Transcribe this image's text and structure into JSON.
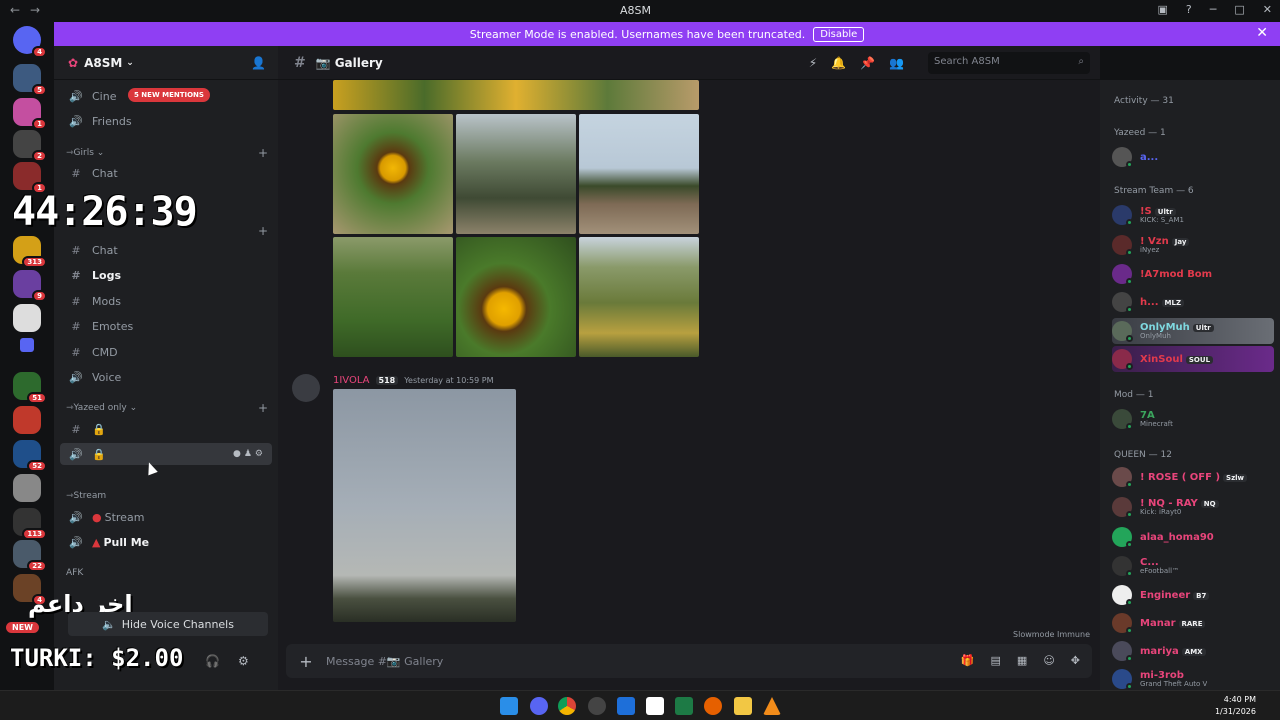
{
  "window": {
    "title": "A8SM"
  },
  "banner": {
    "text": "Streamer Mode is enabled. Usernames have been truncated.",
    "button": "Disable"
  },
  "server_badges": [
    "4",
    "5",
    "1",
    "2",
    "1",
    "313",
    "9",
    "51",
    "52",
    "113",
    "22",
    "4"
  ],
  "guild": {
    "name": "A8SM",
    "mentions_badge": "5 NEW MENTIONS"
  },
  "channels": {
    "cine": "Cine",
    "friends": "Friends",
    "cat_girls": "Girls",
    "girls_chat": "Chat",
    "chat2": "Chat",
    "logs": "Logs",
    "mods": "Mods",
    "emotes": "Emotes",
    "cmd": "CMD",
    "voice": "Voice",
    "cat_yazeed": "Yazeed only",
    "cat_stream": "Stream",
    "stream": "Stream",
    "pullme": "Pull Me",
    "afk": "AFK",
    "hide_vc": "Hide Voice Channels"
  },
  "overlay": {
    "timer": "44:26:39",
    "arabic": "اخر داعم",
    "donor": "TURKI: $2.00",
    "new": "NEW"
  },
  "channel_header": {
    "name": "Gallery",
    "search_placeholder": "Search A8SM"
  },
  "message": {
    "author": "1IVOLA",
    "tag": "518",
    "time": "Yesterday at 10:59 PM"
  },
  "slowmode": "Slowmode Immune",
  "composer": {
    "placeholder": "Message #📷 Gallery"
  },
  "members": {
    "activity": "Activity — 31",
    "yazeed": "Yazeed — 1",
    "yazeed_member": "a...",
    "stream_team": "Stream Team — 6",
    "mod": "Mod — 1",
    "queen": "QUEEN — 12",
    "list": [
      {
        "name": "!S",
        "tag": "Ultr",
        "sub": "KICK: S_AM1",
        "color": "#e23a4c"
      },
      {
        "name": "! Vzn",
        "tag": "Jay",
        "sub": "iNyez",
        "color": "#e23a4c"
      },
      {
        "name": "!A7mod Bom",
        "tag": "",
        "sub": "",
        "color": "#e23a4c"
      },
      {
        "name": "h...",
        "tag": "MLZ",
        "sub": "",
        "color": "#e23a4c"
      },
      {
        "name": "OnlyMuh",
        "tag": "Ultr",
        "sub": "OnlyMuh",
        "color": "#7fd9e0"
      },
      {
        "name": "XinSoul",
        "tag": "SOUL",
        "sub": "",
        "color": "#e23a4c"
      },
      {
        "name": "7A",
        "tag": "",
        "sub": "Minecraft",
        "color": "#3ba55d"
      },
      {
        "name": "! ROSE ( OFF )",
        "tag": "Szlw",
        "sub": "",
        "color": "#e8457b"
      },
      {
        "name": "! NQ - RAY",
        "tag": "NQ",
        "sub": "Kick: iRayt0",
        "color": "#e8457b"
      },
      {
        "name": "alaa_homa90",
        "tag": "",
        "sub": "",
        "color": "#e8457b"
      },
      {
        "name": "C...",
        "tag": "",
        "sub": "eFootball™",
        "color": "#e8457b"
      },
      {
        "name": "Engineer",
        "tag": "B7",
        "sub": "",
        "color": "#e8457b"
      },
      {
        "name": "Manar",
        "tag": "RARE",
        "sub": "",
        "color": "#e8457b"
      },
      {
        "name": "mariya",
        "tag": "AMX",
        "sub": "",
        "color": "#e8457b"
      },
      {
        "name": "mi-3rob",
        "tag": "",
        "sub": "Grand Theft Auto V",
        "color": "#e8457b"
      }
    ]
  },
  "taskbar": {
    "time": "4:40 PM",
    "date": "1/31/2026"
  },
  "colors": {
    "accent": "#8f3ff3",
    "danger": "#da373c"
  }
}
